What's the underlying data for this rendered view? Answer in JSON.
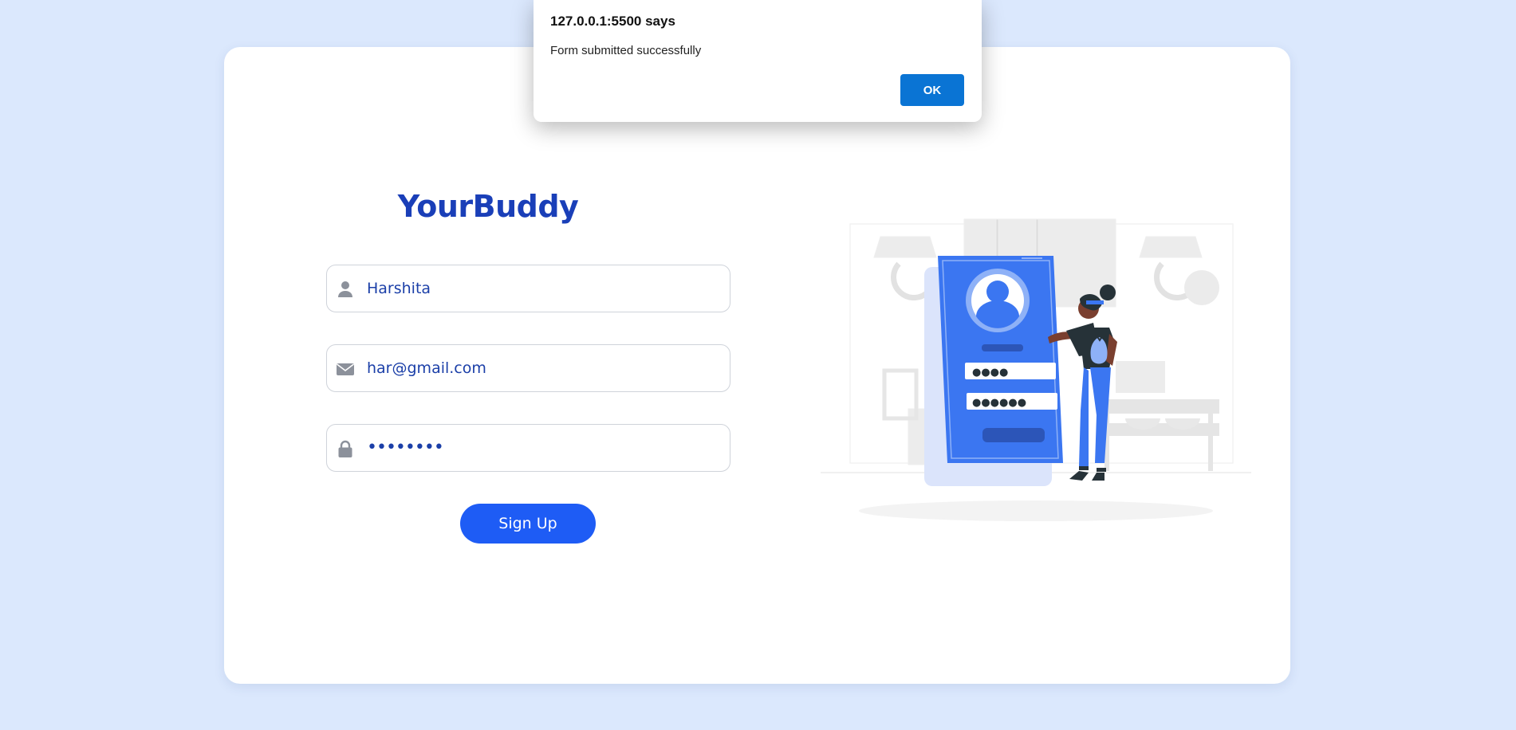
{
  "brand": "YourBuddy",
  "form": {
    "name": {
      "value": "Harshita",
      "icon": "user-icon"
    },
    "email": {
      "value": "har@gmail.com",
      "icon": "envelope-icon"
    },
    "password": {
      "value": "••••••••",
      "icon": "lock-icon"
    },
    "submit_label": "Sign Up"
  },
  "illustration": {
    "pin_dots_1": "●●●●",
    "pin_dots_2": "●●●●●●"
  },
  "alert": {
    "title": "127.0.0.1:5500 says",
    "message": "Form submitted successfully",
    "ok_label": "OK"
  },
  "colors": {
    "page_bg": "#dbe8fd",
    "brand": "#1a3fb8",
    "accent": "#1e5cf5",
    "dialog_button": "#0a74d4"
  }
}
